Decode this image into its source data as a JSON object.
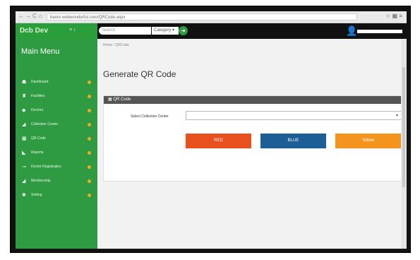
{
  "browser": {
    "nav_back": "←",
    "nav_forward": "→",
    "nav_reload": "C",
    "nav_home": "⌂",
    "url": "banre.webwonderful.com/QRCode.aspx",
    "icons": "☆ ▦ ≡"
  },
  "header": {
    "logo": "Dcb Dev",
    "icons": "≡  ↕",
    "search_placeholder": "Search",
    "category_label": "Category ▾",
    "go_label": "➜",
    "user_name": "——————————"
  },
  "sidebar": {
    "title": "Main Menu",
    "items": [
      {
        "label": "Dashboard",
        "icon": "dashboard-icon"
      },
      {
        "label": "Facilities",
        "icon": "users-icon"
      },
      {
        "label": "Doctors",
        "icon": "doctor-icon"
      },
      {
        "label": "Collection Center",
        "icon": "flag-icon"
      },
      {
        "label": "QR Code",
        "icon": "qr-icon"
      },
      {
        "label": "Reports",
        "icon": "chart-icon"
      },
      {
        "label": "Doctor Registration",
        "icon": "key-icon"
      },
      {
        "label": "Membership",
        "icon": "flag-icon"
      },
      {
        "label": "Setting",
        "icon": "gear-icon"
      }
    ]
  },
  "main": {
    "breadcrumb": "Home / QRCode",
    "title": "Generate QR Code",
    "panel_title": "▦ QR Code",
    "field_label": "Select Collection Center",
    "select_value": "",
    "buttons": {
      "red": "RED",
      "blue": "BLUE",
      "yellow": "Yellow"
    }
  },
  "colors": {
    "sidebar": "#2e9b43",
    "header": "#111111",
    "red": "#e8501e",
    "blue": "#1e5e96",
    "yellow": "#f5931f",
    "badge": "#f5a623"
  }
}
